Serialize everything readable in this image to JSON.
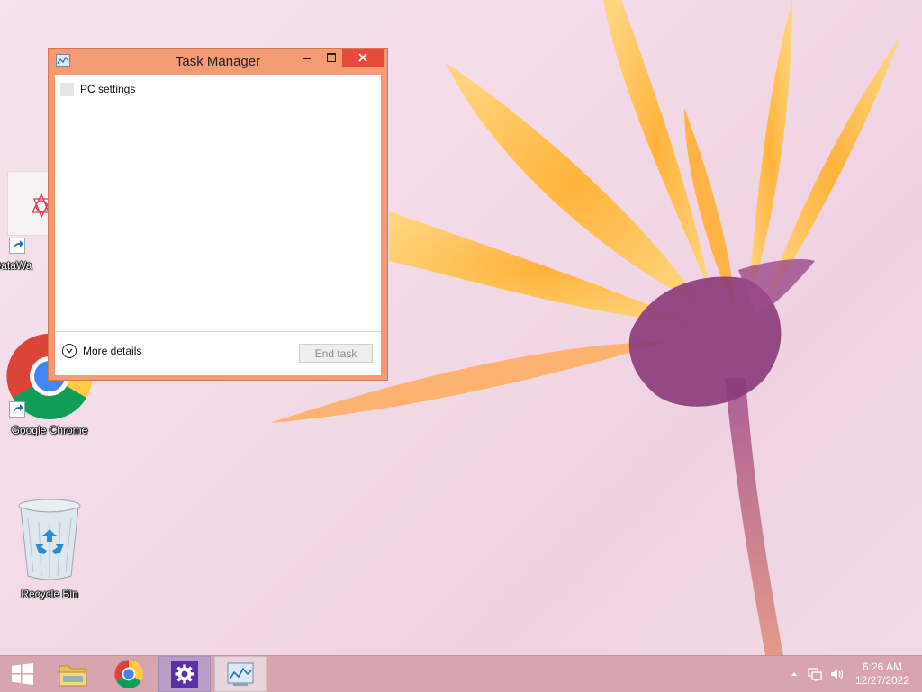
{
  "desktop": {
    "icons": [
      {
        "label": "DataWa",
        "icon": "datawarrior-icon"
      },
      {
        "label": "Google Chrome",
        "icon": "chrome-icon"
      },
      {
        "label": "Recycle Bin",
        "icon": "recycle-bin-icon"
      }
    ]
  },
  "task_manager": {
    "title": "Task Manager",
    "apps": [
      {
        "name": "PC settings"
      }
    ],
    "more_details_label": "More details",
    "end_task_label": "End task",
    "controls": [
      "minimize-icon",
      "maximize-icon",
      "close-icon"
    ],
    "frame_color": "#f39b74",
    "close_color": "#e64a3c"
  },
  "taskbar": {
    "items": [
      {
        "name": "start",
        "icon": "windows-logo-icon"
      },
      {
        "name": "file-explorer",
        "icon": "folder-icon"
      },
      {
        "name": "chrome",
        "icon": "chrome-icon"
      },
      {
        "name": "pc-settings",
        "icon": "gear-icon"
      },
      {
        "name": "task-manager",
        "icon": "task-manager-icon"
      }
    ],
    "tray": {
      "time": "6:26 AM",
      "date": "12/27/2022",
      "icons": [
        "show-hidden-icons-chevron",
        "network-icon",
        "volume-icon"
      ]
    },
    "background": "#d8a4ad"
  }
}
